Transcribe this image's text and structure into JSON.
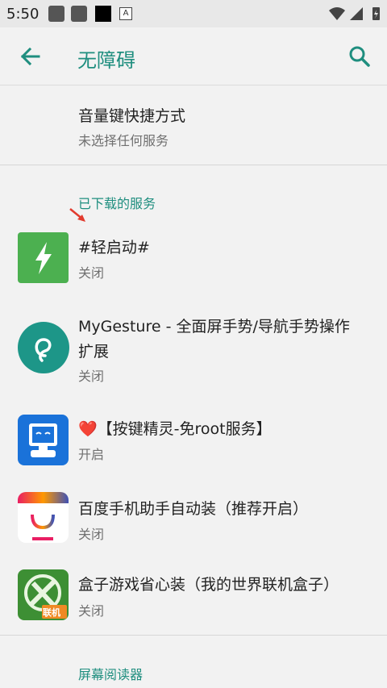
{
  "status_bar": {
    "time": "5:50",
    "notification_a": "A"
  },
  "toolbar": {
    "title": "无障碍",
    "back_icon": "arrow-back-icon",
    "search_icon": "search-icon"
  },
  "shortcut": {
    "title": "音量键快捷方式",
    "subtitle": "未选择任何服务"
  },
  "downloaded_section": {
    "header": "已下载的服务"
  },
  "services": [
    {
      "title": "#轻启动#",
      "status": "关闭",
      "icon": "lightning-app-icon"
    },
    {
      "title_line1": "MyGesture - 全面屏手势/导航手势操作",
      "title_line2": "扩展",
      "status": "关闭",
      "icon": "gesture-app-icon"
    },
    {
      "title_heart": "❤️",
      "title": "【按键精灵-免root服务】",
      "status": "开启",
      "icon": "robot-app-icon"
    },
    {
      "title": "百度手机助手自动装（推荐开启）",
      "status": "关闭",
      "icon": "baidu-assistant-app-icon"
    },
    {
      "title": "盒子游戏省心装（我的世界联机盒子）",
      "status": "关闭",
      "icon": "minecraft-box-app-icon",
      "badge": "联机"
    }
  ],
  "screen_reader_section": {
    "header": "屏幕阅读器"
  },
  "colors": {
    "accent": "#1f8e7f",
    "background": "#f2f2f2"
  }
}
